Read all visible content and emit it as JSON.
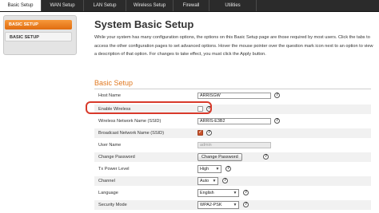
{
  "tabs": [
    {
      "label": "Basic Setup"
    },
    {
      "label": "WAN Setup"
    },
    {
      "label": "LAN Setup"
    },
    {
      "label": "Wireless Setup"
    },
    {
      "label": "Firewall"
    },
    {
      "label": "Utilities"
    }
  ],
  "sidebar": {
    "items": [
      {
        "label": "BASIC SETUP"
      },
      {
        "label": "BASIC SETUP"
      }
    ]
  },
  "main": {
    "title": "System Basic Setup",
    "intro": "While your system has many configuration options, the options on this Basic Setup page are those required by most users. Click the tabs to access the other configuration pages to set advanced options. Hover the mouse pointer over the question mark icon next to an option to view a description of that option. For changes to take effect, you must click the Apply button.",
    "section_title": "Basic Setup"
  },
  "form": {
    "host_name": {
      "label": "Host Name",
      "value": "ARRISGW"
    },
    "enable_wireless": {
      "label": "Enable Wireless",
      "checked": false
    },
    "ssid": {
      "label": "Wireless Network Name (SSID)",
      "value": "ARRIS-E3B2"
    },
    "broadcast_ssid": {
      "label": "Broadcast Network Name (SSID)",
      "checked": true
    },
    "user_name": {
      "label": "User Name",
      "value": "admin"
    },
    "change_password": {
      "label": "Change Password",
      "button": "Change Password"
    },
    "tx_power": {
      "label": "Tx Power Level",
      "value": "High"
    },
    "channel": {
      "label": "Channel",
      "value": "Auto"
    },
    "language": {
      "label": "Language",
      "value": "English"
    },
    "security_mode": {
      "label": "Security Mode",
      "value": "WPA2-PSK"
    }
  },
  "icons": {
    "help": "?",
    "dropdown": "▼"
  },
  "colors": {
    "accent": "#e07820",
    "highlight": "#d83a2b",
    "tabbar": "#2b2b2b"
  }
}
